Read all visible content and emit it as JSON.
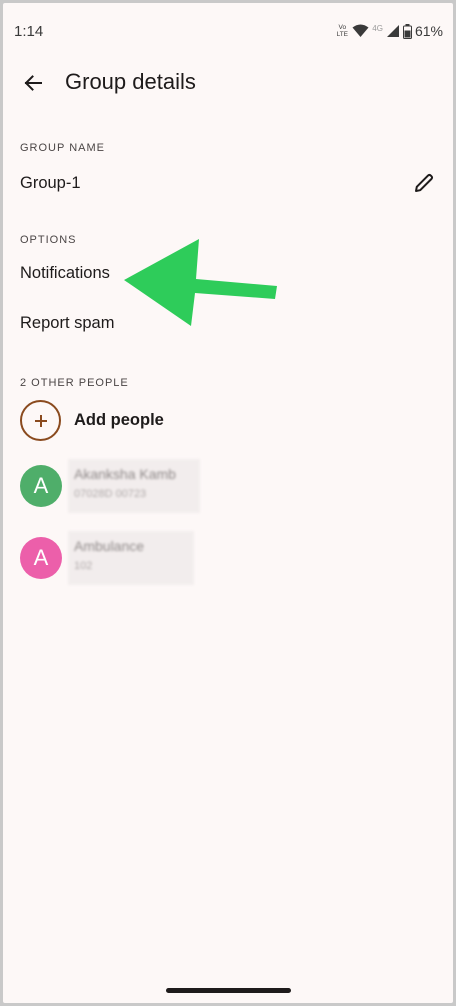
{
  "status_bar": {
    "time": "1:14",
    "volte_top": "Vo",
    "volte_bottom": "LTE",
    "network_label": "4G",
    "battery": "61%"
  },
  "header": {
    "title": "Group details",
    "back_icon": "arrow-back-icon"
  },
  "group_name": {
    "section_label": "GROUP NAME",
    "value": "Group-1",
    "edit_icon": "pencil-icon"
  },
  "options": {
    "section_label": "OPTIONS",
    "items": [
      {
        "label": "Notifications"
      },
      {
        "label": "Report spam"
      }
    ]
  },
  "people": {
    "section_label": "2 OTHER PEOPLE",
    "add_label": "Add people",
    "contacts": [
      {
        "initial": "A",
        "name": "Akanksha Kamb",
        "number": "07028D 00723",
        "color": "#4fae6a"
      },
      {
        "initial": "A",
        "name": "Ambulance",
        "number": "102",
        "color": "#ec5faa"
      }
    ]
  },
  "annotation": {
    "arrow_color": "#2ecc5a"
  }
}
